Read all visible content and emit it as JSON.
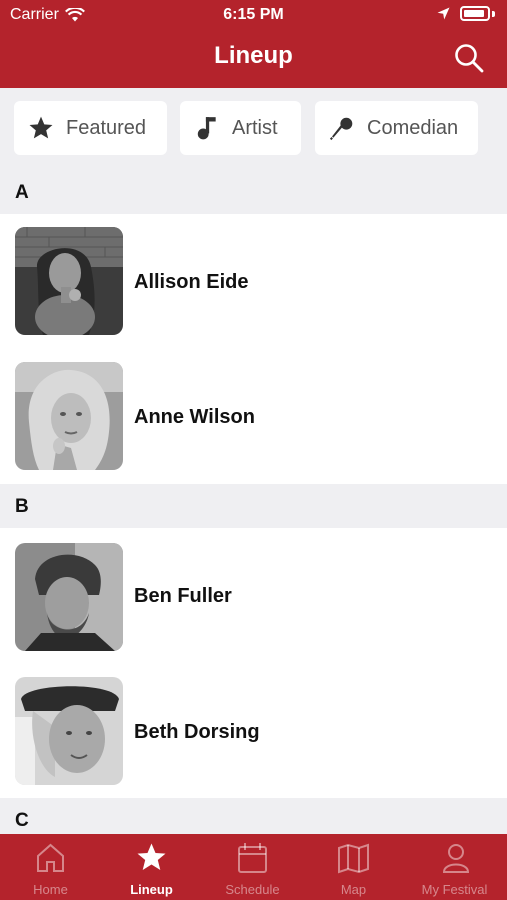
{
  "status": {
    "carrier": "Carrier",
    "time": "6:15 PM"
  },
  "header": {
    "title": "Lineup"
  },
  "filters": [
    {
      "label": "Featured",
      "icon": "star-icon"
    },
    {
      "label": "Artist",
      "icon": "music-note-icon"
    },
    {
      "label": "Comedian",
      "icon": "microphone-icon"
    }
  ],
  "sections": [
    {
      "letter": "A",
      "artists": [
        {
          "name": "Allison Eide"
        },
        {
          "name": "Anne Wilson"
        }
      ]
    },
    {
      "letter": "B",
      "artists": [
        {
          "name": "Ben Fuller"
        },
        {
          "name": "Beth Dorsing"
        }
      ]
    },
    {
      "letter": "C",
      "artists": []
    }
  ],
  "tabs": [
    {
      "label": "Home",
      "icon": "home-icon",
      "active": false
    },
    {
      "label": "Lineup",
      "icon": "star-icon",
      "active": true
    },
    {
      "label": "Schedule",
      "icon": "calendar-icon",
      "active": false
    },
    {
      "label": "Map",
      "icon": "map-icon",
      "active": false
    },
    {
      "label": "My Festival",
      "icon": "person-icon",
      "active": false
    }
  ],
  "colors": {
    "brand": "#b4232c",
    "background": "#efeff2"
  }
}
